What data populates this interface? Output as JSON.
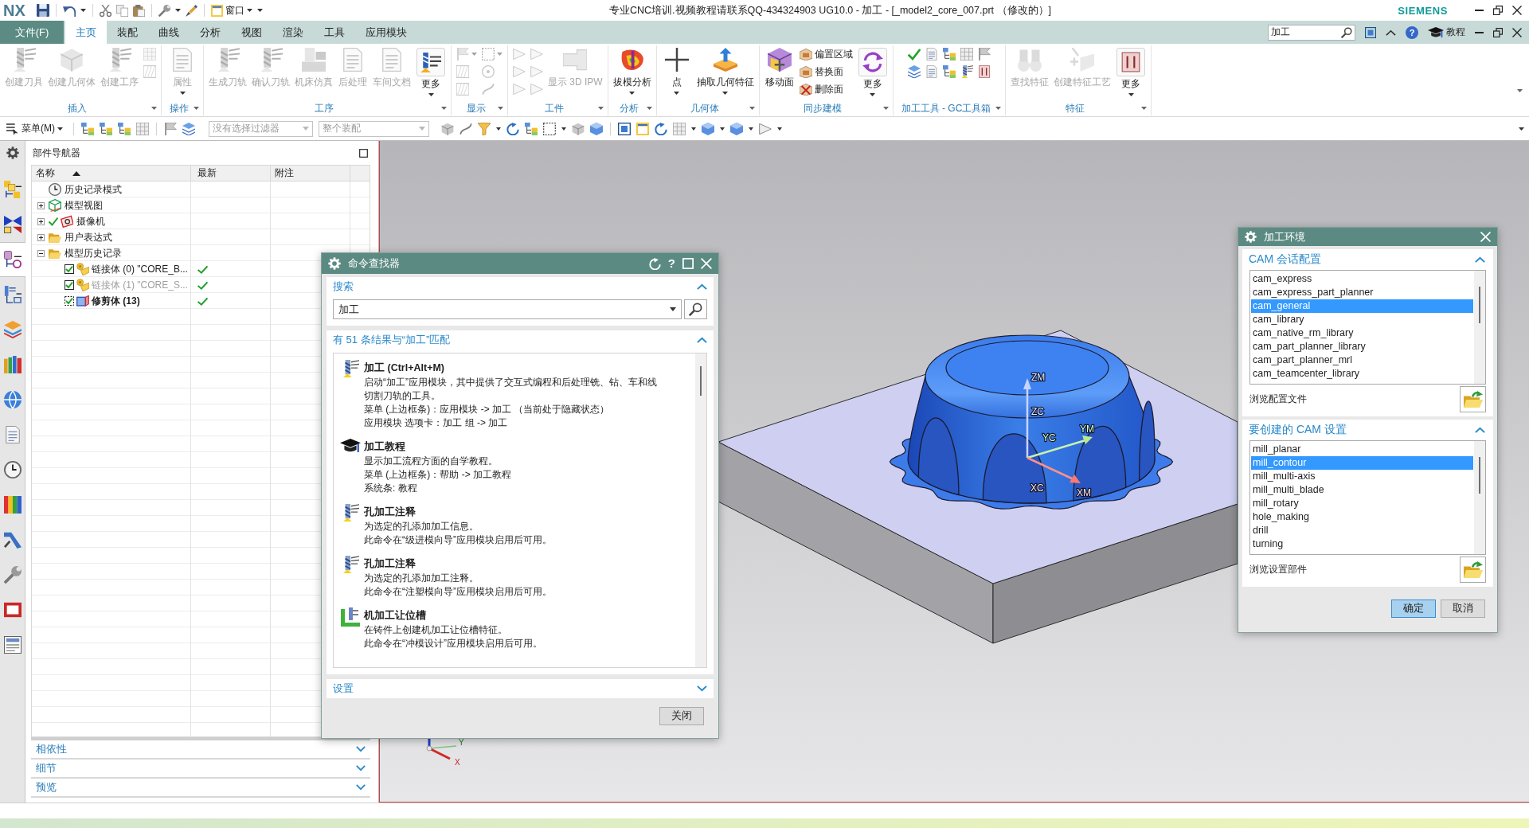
{
  "title_bar": {
    "logo": "NX",
    "window_menu": "窗口",
    "title": "专业CNC培训.视频教程请联系QQ-434324903 UG10.0 - 加工 - [_model2_core_007.prt （修改的）]",
    "brand": "SIEMENS"
  },
  "menu_bar": {
    "file_menu": "文件(F)",
    "tabs": [
      {
        "label": "主页",
        "selected": true
      },
      {
        "label": "装配",
        "selected": false
      },
      {
        "label": "曲线",
        "selected": false
      },
      {
        "label": "分析",
        "selected": false
      },
      {
        "label": "视图",
        "selected": false
      },
      {
        "label": "渲染",
        "selected": false
      },
      {
        "label": "工具",
        "selected": false
      },
      {
        "label": "应用模块",
        "selected": false
      }
    ],
    "command_search": {
      "value": "加工"
    },
    "help_button": "?",
    "tutorial_label": "教程"
  },
  "ribbon": {
    "groups": [
      {
        "label": "插入",
        "items": [
          {
            "kind": "large",
            "label": "创建刀具",
            "disabled": true,
            "dropdown": false
          },
          {
            "kind": "large",
            "label": "创建几何体",
            "disabled": true,
            "dropdown": false
          },
          {
            "kind": "large",
            "label": "创建工序",
            "disabled": true,
            "dropdown": false
          },
          {
            "kind": "stack",
            "items": [
              {
                "disabled": true,
                "dropdown": false
              },
              {
                "disabled": true,
                "dropdown": false
              }
            ]
          }
        ]
      },
      {
        "label": "操作",
        "items": [
          {
            "kind": "large",
            "label": "属性",
            "disabled": true,
            "dropdown": true
          }
        ]
      },
      {
        "label": "工序",
        "items": [
          {
            "kind": "large",
            "label": "生成刀轨",
            "disabled": true,
            "dropdown": false
          },
          {
            "kind": "large",
            "label": "确认刀轨",
            "disabled": true,
            "dropdown": false
          },
          {
            "kind": "large",
            "label": "机床仿真",
            "disabled": true,
            "dropdown": false
          },
          {
            "kind": "large",
            "label": "后处理",
            "disabled": true,
            "dropdown": false
          },
          {
            "kind": "large",
            "label": "车间文档",
            "disabled": true,
            "dropdown": false
          },
          {
            "kind": "more",
            "label": "更多",
            "disabled": false,
            "dropdown": true
          }
        ]
      },
      {
        "label": "显示",
        "items": [
          {
            "kind": "stack",
            "items": [
              {
                "disabled": true,
                "dropdown": true
              },
              {
                "disabled": true,
                "dropdown": false
              },
              {
                "disabled": true,
                "dropdown": false
              }
            ]
          },
          {
            "kind": "stack",
            "items": [
              {
                "disabled": true,
                "dropdown": true
              },
              {
                "disabled": true,
                "dropdown": false
              },
              {
                "disabled": true,
                "dropdown": false
              }
            ]
          }
        ]
      },
      {
        "label": "工件",
        "items": [
          {
            "kind": "stack",
            "items": [
              {
                "disabled": true,
                "dropdown": false
              },
              {
                "disabled": true,
                "dropdown": false
              },
              {
                "disabled": true,
                "dropdown": false
              }
            ]
          },
          {
            "kind": "stack",
            "items": [
              {
                "disabled": true,
                "dropdown": false
              },
              {
                "disabled": true,
                "dropdown": false
              },
              {
                "disabled": true,
                "dropdown": false
              }
            ]
          },
          {
            "kind": "large",
            "label": "显示 3D IPW",
            "disabled": true,
            "dropdown": false
          }
        ]
      },
      {
        "label": "分析",
        "items": [
          {
            "kind": "large",
            "label": "拔模分析",
            "disabled": false,
            "dropdown": true
          }
        ]
      },
      {
        "label": "几何体",
        "items": [
          {
            "kind": "large",
            "label": "点",
            "disabled": false,
            "dropdown": true
          },
          {
            "kind": "large",
            "label": "抽取几何特征",
            "disabled": false,
            "dropdown": true
          }
        ]
      },
      {
        "label": "同步建模",
        "items": [
          {
            "kind": "large",
            "label": "移动面",
            "disabled": false,
            "dropdown": false
          },
          {
            "kind": "stack",
            "items": [
              {
                "label": "偏置区域",
                "disabled": false,
                "dropdown": false
              },
              {
                "label": "替换面",
                "disabled": false,
                "dropdown": false
              },
              {
                "label": "删除面",
                "disabled": false,
                "dropdown": false
              }
            ]
          },
          {
            "kind": "more",
            "label": "更多",
            "disabled": false,
            "dropdown": true
          }
        ]
      },
      {
        "label": "加工工具 - GC工具箱",
        "items": [
          {
            "kind": "stack",
            "items": [
              {
                "disabled": false,
                "dropdown": false
              },
              {
                "disabled": false,
                "dropdown": false
              }
            ]
          },
          {
            "kind": "stack",
            "items": [
              {
                "disabled": false,
                "dropdown": false
              },
              {
                "disabled": false,
                "dropdown": false
              }
            ]
          },
          {
            "kind": "stack",
            "items": [
              {
                "disabled": false,
                "dropdown": false
              },
              {
                "disabled": false,
                "dropdown": false
              }
            ]
          },
          {
            "kind": "stack",
            "items": [
              {
                "disabled": false,
                "dropdown": false
              },
              {
                "disabled": false,
                "dropdown": false
              }
            ]
          },
          {
            "kind": "stack",
            "items": [
              {
                "disabled": false,
                "dropdown": false
              },
              {
                "disabled": false,
                "dropdown": false
              }
            ]
          }
        ]
      },
      {
        "label": "特征",
        "items": [
          {
            "kind": "large",
            "label": "查找特征",
            "disabled": true,
            "dropdown": false
          },
          {
            "kind": "large",
            "label": "创建特征工艺",
            "disabled": true,
            "dropdown": false
          },
          {
            "kind": "more",
            "label": "更多",
            "disabled": false,
            "dropdown": true
          }
        ]
      }
    ]
  },
  "toolbar": {
    "menu_button": "菜单(M)",
    "filters": [
      {
        "value": "没有选择过滤器",
        "disabled": true
      },
      {
        "value": "整个装配",
        "disabled": true
      }
    ]
  },
  "resource_bar": {
    "tabs": [
      {
        "selected": false
      },
      {
        "selected": false
      },
      {
        "selected": true
      },
      {
        "selected": false
      },
      {
        "selected": false
      },
      {
        "selected": false
      },
      {
        "selected": false
      },
      {
        "selected": false
      },
      {
        "selected": false
      },
      {
        "selected": false
      },
      {
        "selected": false
      },
      {
        "selected": false
      },
      {
        "selected": false
      },
      {
        "selected": false
      }
    ]
  },
  "part_navigator": {
    "title": "部件导航器",
    "columns": [
      {
        "label": "名称",
        "sorted": true
      },
      {
        "label": "最新",
        "sorted": false
      },
      {
        "label": "附注",
        "sorted": false
      }
    ],
    "tree": [
      {
        "kind": "mode",
        "label": "历史记录模式",
        "checked": false
      },
      {
        "kind": "views",
        "label": "模型视图",
        "expanded": false,
        "checked": false
      },
      {
        "kind": "cameras",
        "label": "摄像机",
        "expanded": false,
        "checked": true
      },
      {
        "kind": "expressions",
        "label": "用户表达式",
        "expanded": false,
        "checked": false
      },
      {
        "kind": "history",
        "label": "模型历史记录",
        "expanded": true,
        "checked": false,
        "children": [
          {
            "kind": "linked",
            "label": "链接体 (0) \"CORE_B...",
            "checked": true,
            "dimmed": false,
            "current": false,
            "up_to_date": true
          },
          {
            "kind": "linked",
            "label": "链接体 (1) \"CORE_S...",
            "checked": true,
            "dimmed": true,
            "current": false,
            "up_to_date": true
          },
          {
            "kind": "trim",
            "label": "修剪体 (13)",
            "checked": true,
            "dimmed": false,
            "current": true,
            "up_to_date": true
          }
        ]
      }
    ],
    "panels": [
      {
        "label": "相依性",
        "expanded": false
      },
      {
        "label": "细节",
        "expanded": false
      },
      {
        "label": "预览",
        "expanded": false
      }
    ]
  },
  "viewport": {
    "model_axis_labels": [
      "ZM",
      "ZC",
      "YC",
      "YM",
      "XC",
      "XM"
    ],
    "triad_labels": [
      "Y",
      "X"
    ]
  },
  "command_finder": {
    "title": "命令查找器",
    "help_button": "?",
    "search": {
      "label": "搜索",
      "expanded": true,
      "query": "加工"
    },
    "results": {
      "label": "有 51 条结果与“加工”匹配",
      "expanded": true,
      "items": [
        {
          "kind": "application",
          "title": "加工 (Ctrl+Alt+M)",
          "lines": [
            "启动“加工”应用模块，其中提供了交互式编程和后处理铣、钻、车和线切割刀轨的工具。",
            "菜单 (上边框条)：应用模块 -> 加工 （当前处于隐藏状态）",
            "应用模块 选项卡：加工 组 -> 加工"
          ]
        },
        {
          "kind": "tutorial",
          "title": "加工教程",
          "lines": [
            "显示加工流程方面的自学教程。",
            "菜单 (上边框条)：帮助 -> 加工教程",
            "系统条: 教程"
          ]
        },
        {
          "kind": "command",
          "title": "孔加工注释",
          "lines": [
            "为选定的孔添加加工信息。",
            "此命令在“级进模向导”应用模块启用后可用。"
          ]
        },
        {
          "kind": "command",
          "title": "孔加工注释",
          "lines": [
            "为选定的孔添加加工注释。",
            "此命令在“注塑模向导”应用模块启用后可用。"
          ]
        },
        {
          "kind": "feature",
          "title": "机加工让位槽",
          "lines": [
            "在铸件上创建机加工让位槽特征。",
            "此命令在“冲模设计”应用模块启用后可用。"
          ]
        }
      ]
    },
    "settings": {
      "label": "设置",
      "expanded": false
    },
    "close_button": "关闭"
  },
  "machining_environment": {
    "title": "加工环境",
    "session_config": {
      "label": "CAM 会话配置",
      "expanded": true,
      "items": [
        {
          "label": "cam_express",
          "selected": false
        },
        {
          "label": "cam_express_part_planner",
          "selected": false
        },
        {
          "label": "cam_general",
          "selected": true
        },
        {
          "label": "cam_library",
          "selected": false
        },
        {
          "label": "cam_native_rm_library",
          "selected": false
        },
        {
          "label": "cam_part_planner_library",
          "selected": false
        },
        {
          "label": "cam_part_planner_mrl",
          "selected": false
        },
        {
          "label": "cam_teamcenter_library",
          "selected": false
        }
      ],
      "browse_label": "浏览配置文件"
    },
    "setup": {
      "label": "要创建的 CAM 设置",
      "expanded": true,
      "items": [
        {
          "label": "mill_planar",
          "selected": false
        },
        {
          "label": "mill_contour",
          "selected": true
        },
        {
          "label": "mill_multi-axis",
          "selected": false
        },
        {
          "label": "mill_multi_blade",
          "selected": false
        },
        {
          "label": "mill_rotary",
          "selected": false
        },
        {
          "label": "hole_making",
          "selected": false
        },
        {
          "label": "drill",
          "selected": false
        },
        {
          "label": "turning",
          "selected": false
        }
      ],
      "browse_label": "浏览设置部件"
    },
    "buttons": [
      {
        "label": "确定",
        "kind": "primary"
      },
      {
        "label": "取消",
        "kind": "normal"
      }
    ]
  }
}
